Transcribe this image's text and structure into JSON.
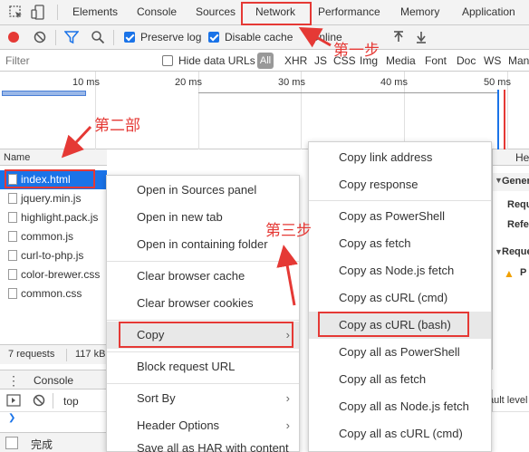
{
  "colors": {
    "accent": "#1a73e8",
    "annotation": "#e53935",
    "record": "#e53935"
  },
  "tabs": [
    "Elements",
    "Console",
    "Sources",
    "Network",
    "Performance",
    "Memory",
    "Application"
  ],
  "toolbar": {
    "preserve_log": "Preserve log",
    "disable_cache": "Disable cache",
    "online": "Online"
  },
  "filter": {
    "placeholder": "Filter",
    "hide_data_urls": "Hide data URLs",
    "types": [
      "All",
      "XHR",
      "JS",
      "CSS",
      "Img",
      "Media",
      "Font",
      "Doc",
      "WS",
      "Man"
    ]
  },
  "timeline": {
    "ticks": [
      "10 ms",
      "20 ms",
      "30 ms",
      "40 ms",
      "50 ms"
    ]
  },
  "requests": {
    "header": "Name",
    "items": [
      "index.html",
      "jquery.min.js",
      "highlight.pack.js",
      "common.js",
      "curl-to-php.js",
      "color-brewer.css",
      "common.css"
    ],
    "status": "7 requests",
    "size": "117 kB"
  },
  "right_panel": {
    "tab": "He",
    "general": "Gener",
    "row1": "Requ",
    "row2": "Refe",
    "req": "Reque",
    "warn": "P"
  },
  "drawer": {
    "tab": "Console",
    "context": "top",
    "levels": "ault level",
    "bottom": "完成"
  },
  "context_menu": {
    "items": [
      "Open in Sources panel",
      "Open in new tab",
      "Open in containing folder",
      "Clear browser cache",
      "Clear browser cookies",
      "Copy",
      "Block request URL",
      "Sort By",
      "Header Options"
    ],
    "partial": "Save all as HAR with content"
  },
  "submenu": {
    "items": [
      "Copy link address",
      "Copy response",
      "Copy as PowerShell",
      "Copy as fetch",
      "Copy as Node.js fetch",
      "Copy as cURL (cmd)",
      "Copy as cURL (bash)",
      "Copy all as PowerShell",
      "Copy all as fetch",
      "Copy all as Node.js fetch",
      "Copy all as cURL (cmd)"
    ]
  },
  "annotations": {
    "step1": "第一步",
    "step2": "第二部",
    "step3": "第三步"
  }
}
